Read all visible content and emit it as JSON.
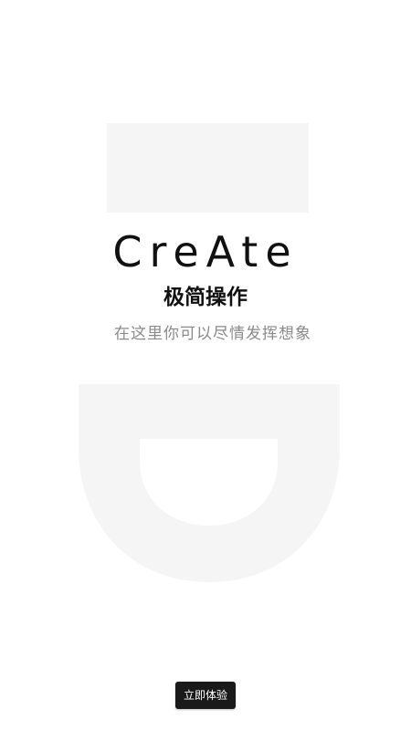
{
  "splash": {
    "headline": "CreAte",
    "subtitle": "极简操作",
    "tagline": "在这里你可以尽情发挥想象"
  },
  "cta": {
    "label": "立即体验"
  },
  "colors": {
    "background": "#ffffff",
    "decor": "#f5f5f5",
    "headline": "#111111",
    "tagline": "#8a8a8a",
    "button_bg": "#1a1a1a",
    "button_text": "#ffffff"
  }
}
